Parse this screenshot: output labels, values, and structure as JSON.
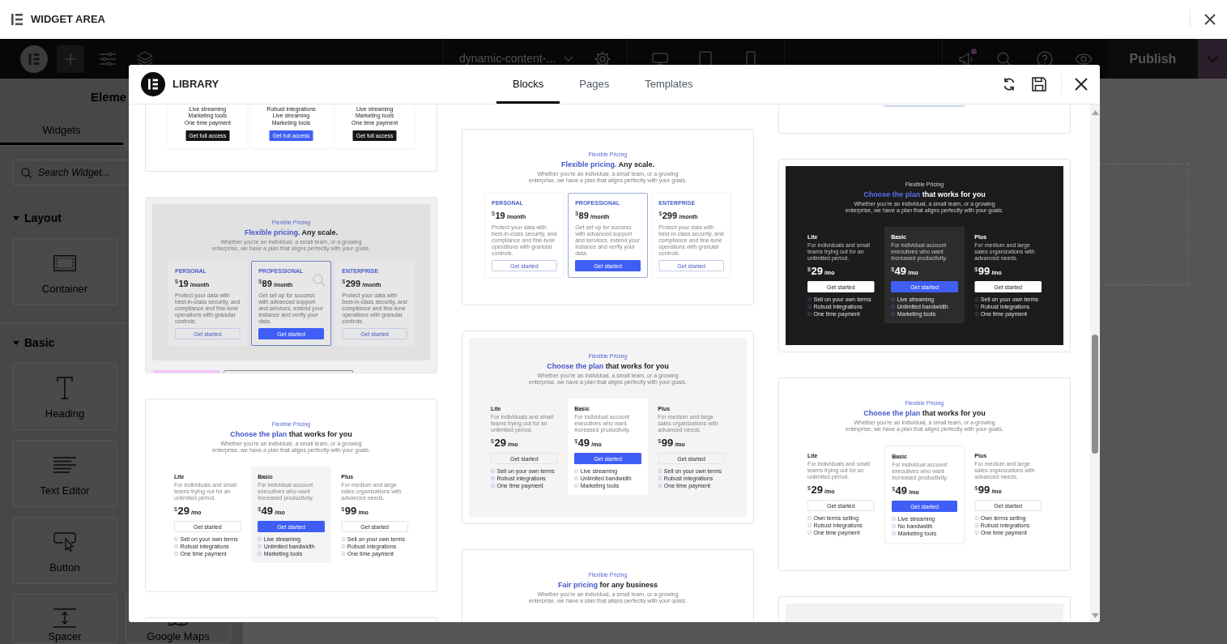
{
  "window": {
    "title": "WIDGET AREA"
  },
  "toolbar": {
    "page_title": "dynamic-content-...",
    "notification": true,
    "publish": "Publish"
  },
  "panel": {
    "title": "Eleme",
    "tabs": [
      {
        "label": "Widgets",
        "selected": true
      }
    ],
    "search": {
      "placeholder": "Search Widget..."
    },
    "sections": [
      {
        "title": "Layout",
        "expanded": true,
        "rows": [
          [
            {
              "label": "Container",
              "kind": "container"
            }
          ]
        ]
      },
      {
        "title": "Basic",
        "expanded": true,
        "rows": [
          [
            {
              "label": "Heading",
              "kind": "heading"
            }
          ],
          [
            {
              "label": "Text Editor",
              "kind": "text"
            }
          ],
          [
            {
              "label": "Button",
              "kind": "button"
            }
          ],
          [
            {
              "label": "Spacer",
              "kind": "spacer"
            },
            {
              "label": "Google Maps",
              "kind": "map"
            }
          ]
        ]
      }
    ]
  },
  "library": {
    "title": "LIBRARY",
    "tabs": [
      {
        "label": "Blocks",
        "selected": true
      },
      {
        "label": "Pages",
        "selected": false
      },
      {
        "label": "Templates",
        "selected": false
      }
    ],
    "columns": [
      [
        {
          "kind": "tail",
          "hovered": false,
          "plans": [
            {
              "featured": false,
              "features": [
                "Live streaming",
                "Marketing tools",
                "One time payment"
              ],
              "button": "Get full access"
            },
            {
              "featured": true,
              "features": [
                "Robust integrations",
                "Live streaming",
                "Marketing tools"
              ],
              "button": "Get full access"
            },
            {
              "featured": false,
              "features": [
                "Live streaming",
                "Marketing tools",
                "One time payment"
              ],
              "button": "Get full access"
            }
          ]
        },
        {
          "kind": "tiers",
          "hovered": true,
          "more_below": true,
          "eyebrow": "Flexible Pricing",
          "heading_accent": "Flexible pricing.",
          "heading_rest": "Any scale.",
          "description": "Whether you're an individual, a small team, or a growing enterprise, we have a plan that aligns perfectly with your goals.",
          "plans": [
            {
              "name": "PERSONAL",
              "currency": "$",
              "amount": "19",
              "period": "/month",
              "description": "Protect your data with best-in-class security, and compliance and fine-tune operations with granular controls.",
              "button": "Get started",
              "featured": false
            },
            {
              "name": "PROFESSIONAL",
              "currency": "$",
              "amount": "89",
              "period": "/month",
              "description": "Get set up for success with advanced support and services, extend your instance and verify your data.",
              "button": "Get started",
              "featured": true
            },
            {
              "name": "ENTERPRISE",
              "currency": "$",
              "amount": "299",
              "period": "/month",
              "description": "Protect your data with best-in-class security, and compliance and fine-tune operations with granular controls.",
              "button": "Get started",
              "featured": false
            }
          ]
        },
        {
          "kind": "plans",
          "color": "#ffffff",
          "hovered": false,
          "eyebrow": "Flexible Pricing",
          "heading_accent": "Choose the plan",
          "heading_rest": "that works for you",
          "description": "Whether you're an individual, a small team, or a growing enterprise, we have a plan that aligns perfectly with your goals.",
          "plans": [
            {
              "name": "Lite",
              "description": "For individuals and small teams trying out for an unlimited period.",
              "currency": "$",
              "amount": "29",
              "period": "/mo",
              "button": "Get started",
              "featured": false,
              "features": [
                "Sell on your own terms",
                "Robust integrations",
                "One time payment"
              ]
            },
            {
              "name": "Basic",
              "description": "For individual account executives who want increased productivity.",
              "currency": "$",
              "amount": "49",
              "period": "/mo",
              "button": "Get started",
              "featured": true,
              "features": [
                "Live streaming",
                "Unlimited bandwidth",
                "Marketing tools"
              ]
            },
            {
              "name": "Plus",
              "description": "For medium and large sales organizations with advanced needs.",
              "currency": "$",
              "amount": "99",
              "period": "/mo",
              "button": "Get started",
              "featured": false,
              "features": [
                "Sell on your own terms",
                "Robust integrations",
                "One time payment"
              ]
            }
          ]
        },
        {
          "kind": "blank",
          "hovered": false
        }
      ],
      [
        {
          "kind": "tiers",
          "hovered": false,
          "eyebrow": "Flexible Pricing",
          "heading_accent": "Flexible pricing.",
          "heading_rest": "Any scale.",
          "description": "Whether you're an individual, a small team, or a growing enterprise, we have a plan that aligns perfectly with your goals.",
          "plans": [
            {
              "name": "PERSONAL",
              "currency": "$",
              "amount": "19",
              "period": "/month",
              "description": "Protect your data with best-in-class security, and compliance and fine-tune operations with granular controls.",
              "button": "Get started",
              "featured": false
            },
            {
              "name": "PROFESSIONAL",
              "currency": "$",
              "amount": "89",
              "period": "/month",
              "description": "Get set up for success with advanced support and services, extend your instance and verify your data.",
              "button": "Get started",
              "featured": true
            },
            {
              "name": "ENTERPRISE",
              "currency": "$",
              "amount": "299",
              "period": "/month",
              "description": "Protect your data with best-in-class security, and compliance and fine-tune operations with granular controls.",
              "button": "Get started",
              "featured": false
            }
          ]
        },
        {
          "kind": "plans",
          "color": "#f4f4f5",
          "hovered": false,
          "eyebrow": "Flexible Pricing",
          "heading_accent": "Choose the plan",
          "heading_rest": "that works for you",
          "description": "Whether you're an individual, a small team, or a growing enterprise, we have a plan that aligns perfectly with your goals.",
          "plans": [
            {
              "name": "Lite",
              "description": "For individuals and small teams trying out for an unlimited period.",
              "currency": "$",
              "amount": "29",
              "period": "/mo",
              "button": "Get started",
              "featured": false,
              "features": [
                "Sell on your own terms",
                "Robust integrations",
                "One time payment"
              ]
            },
            {
              "name": "Basic",
              "description": "For individual account executives who want increased productivity.",
              "currency": "$",
              "amount": "49",
              "period": "/mo",
              "button": "Get started",
              "featured": true,
              "features": [
                "Live streaming",
                "Unlimited bandwidth",
                "Marketing tools"
              ]
            },
            {
              "name": "Plus",
              "description": "For medium and large sales organizations with advanced needs.",
              "currency": "$",
              "amount": "99",
              "period": "/mo",
              "button": "Get started",
              "featured": false,
              "features": [
                "Sell on your own terms",
                "Robust integrations",
                "One time payment"
              ]
            }
          ]
        },
        {
          "kind": "heading",
          "hovered": false,
          "eyebrow": "Flexible Pricing",
          "heading_accent": "Fair pricing",
          "heading_rest": "for any business",
          "description": "Whether you're an individual, a small team, or a growing enterprise, we have a plan that aligns perfectly with your goals."
        }
      ],
      [
        {
          "kind": "edge",
          "hovered": false
        },
        {
          "kind": "plans",
          "color": "#1c1c1d",
          "hovered": false,
          "eyebrow": "Flexible Pricing",
          "heading_accent": "Choose the plan",
          "heading_rest": "that works for you",
          "description": "Whether you're an individual, a small team, or a growing enterprise, we have a plan that aligns perfectly with your goals.",
          "plans": [
            {
              "name": "Lite",
              "description": "For individuals and small teams trying out for an unlimited period.",
              "currency": "$",
              "amount": "29",
              "period": "/mo",
              "button": "Get started",
              "featured": false,
              "features": [
                "Sell on your own terms",
                "Robust integrations",
                "One time payment"
              ]
            },
            {
              "name": "Basic",
              "description": "For individual account executives who want increased productivity.",
              "currency": "$",
              "amount": "49",
              "period": "/mo",
              "button": "Get started",
              "featured": true,
              "features": [
                "Live streaming",
                "Unlimited bandwidth",
                "Marketing tools"
              ]
            },
            {
              "name": "Plus",
              "description": "For medium and large sales organizations with advanced needs.",
              "currency": "$",
              "amount": "99",
              "period": "/mo",
              "button": "Get started",
              "featured": false,
              "features": [
                "Sell on your own terms",
                "Robust integrations",
                "One time payment"
              ]
            }
          ]
        },
        {
          "kind": "cards",
          "color": "#ffffff",
          "hovered": false,
          "eyebrow": "Flexible Pricing",
          "heading_accent": "Choose the plan",
          "heading_rest": "that works for you",
          "description": "Whether you're an individual, a small team, or a growing enterprise, we have a plan that aligns perfectly with your goals.",
          "plans": [
            {
              "name": "Lite",
              "description": "For individuals and small teams trying out for an unlimited period.",
              "currency": "$",
              "amount": "29",
              "period": "/mo",
              "button": "Get started",
              "featured": false,
              "features": [
                "Own terms selling",
                "Robust integrations",
                "One time payment"
              ]
            },
            {
              "name": "Basic",
              "description": "For individual account executives who want increased productivity.",
              "currency": "$",
              "amount": "49",
              "period": "/mo",
              "button": "Get started",
              "featured": true,
              "features": [
                "Live streaming",
                "No bandwidth",
                "Marketing tools"
              ]
            },
            {
              "name": "Plus",
              "description": "For medium and large sales organizations with advanced needs.",
              "currency": "$",
              "amount": "99",
              "period": "/mo",
              "button": "Get started",
              "featured": false,
              "features": [
                "Own terms selling",
                "Robust integrations",
                "One time payment"
              ]
            }
          ]
        },
        {
          "kind": "blank",
          "color": "#f2f2f3",
          "hovered": false
        }
      ]
    ]
  }
}
